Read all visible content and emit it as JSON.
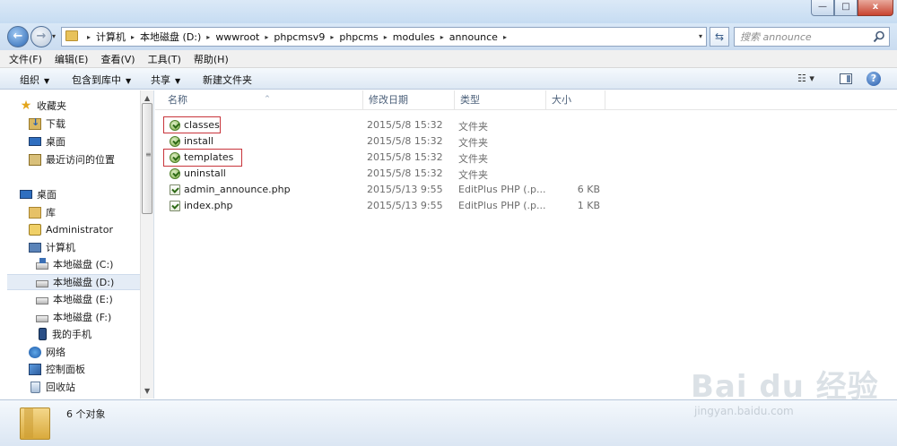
{
  "window": {
    "minimize_glyph": "—",
    "maximize_glyph": "□",
    "close_glyph": "x"
  },
  "nav": {
    "back_glyph": "←",
    "forward_glyph": "→",
    "dropdown_glyph": "▾"
  },
  "address": {
    "crumbs": [
      "计算机",
      "本地磁盘 (D:)",
      "wwwroot",
      "phpcmsv9",
      "phpcms",
      "modules",
      "announce"
    ],
    "separator": "▸",
    "dropdown_glyph": "▾"
  },
  "refresh_glyph": "⇆",
  "search": {
    "placeholder": "搜索 announce"
  },
  "menu": {
    "items": [
      "文件(F)",
      "编辑(E)",
      "查看(V)",
      "工具(T)",
      "帮助(H)"
    ]
  },
  "toolbar": {
    "organize": "组织",
    "include_in_library": "包含到库中",
    "share": "共享",
    "new_folder": "新建文件夹",
    "dropdown_glyph": "▼",
    "views_glyph": "☷ ▾",
    "help_glyph": "?"
  },
  "sidebar": {
    "items": [
      {
        "label": "收藏夹",
        "icon": "star-icon"
      },
      {
        "label": "下载",
        "icon": "download-folder-icon"
      },
      {
        "label": "桌面",
        "icon": "desktop-icon"
      },
      {
        "label": "最近访问的位置",
        "icon": "recent-places-icon"
      },
      {
        "label": "桌面",
        "icon": "desktop-icon"
      },
      {
        "label": "库",
        "icon": "library-icon"
      },
      {
        "label": "Administrator",
        "icon": "user-folder-icon"
      },
      {
        "label": "计算机",
        "icon": "computer-icon"
      },
      {
        "label": "本地磁盘 (C:)",
        "icon": "system-drive-icon"
      },
      {
        "label": "本地磁盘 (D:)",
        "icon": "drive-icon",
        "selected": true
      },
      {
        "label": "本地磁盘 (E:)",
        "icon": "drive-icon"
      },
      {
        "label": "本地磁盘 (F:)",
        "icon": "drive-icon"
      },
      {
        "label": "我的手机",
        "icon": "phone-icon"
      },
      {
        "label": "网络",
        "icon": "network-icon"
      },
      {
        "label": "控制面板",
        "icon": "control-panel-icon"
      },
      {
        "label": "回收站",
        "icon": "recycle-bin-icon"
      }
    ],
    "scroll_up_glyph": "▲",
    "scroll_down_glyph": "▼",
    "scroll_grip_glyph": "≡"
  },
  "columns": {
    "name": "名称",
    "date_modified": "修改日期",
    "type": "类型",
    "size": "大小",
    "sort_glyph": "^"
  },
  "files": [
    {
      "name": "classes",
      "date": "2015/5/8 15:32",
      "type": "文件夹",
      "size": "",
      "kind": "folder"
    },
    {
      "name": "install",
      "date": "2015/5/8 15:32",
      "type": "文件夹",
      "size": "",
      "kind": "folder"
    },
    {
      "name": "templates",
      "date": "2015/5/8 15:32",
      "type": "文件夹",
      "size": "",
      "kind": "folder"
    },
    {
      "name": "uninstall",
      "date": "2015/5/8 15:32",
      "type": "文件夹",
      "size": "",
      "kind": "folder"
    },
    {
      "name": "admin_announce.php",
      "date": "2015/5/13 9:55",
      "type": "EditPlus PHP (.p...",
      "size": "6 KB",
      "kind": "file"
    },
    {
      "name": "index.php",
      "date": "2015/5/13 9:55",
      "type": "EditPlus PHP (.p...",
      "size": "1 KB",
      "kind": "file"
    }
  ],
  "status": {
    "item_count": "6 个对象"
  },
  "watermark": {
    "logo": "Bai du 经验",
    "url": "jingyan.baidu.com"
  },
  "colors": {
    "highlight_box": "#c8343b",
    "selection": "#e4ecf6",
    "chrome_blue": "#cadcf0"
  }
}
